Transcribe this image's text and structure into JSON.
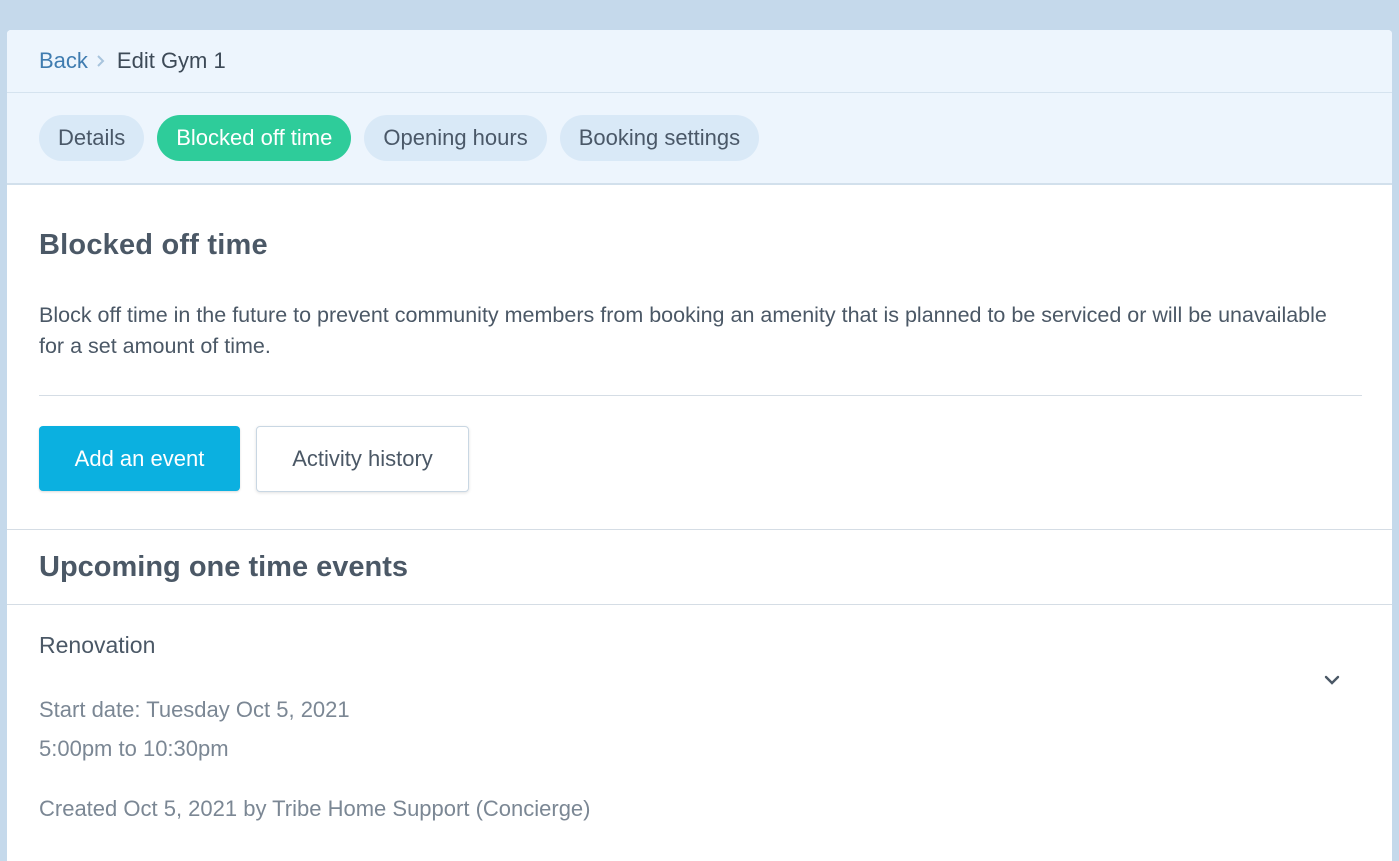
{
  "breadcrumb": {
    "back_label": "Back",
    "current": "Edit Gym 1"
  },
  "tabs": [
    {
      "label": "Details",
      "active": false
    },
    {
      "label": "Blocked off time",
      "active": true
    },
    {
      "label": "Opening hours",
      "active": false
    },
    {
      "label": "Booking settings",
      "active": false
    }
  ],
  "section": {
    "title": "Blocked off time",
    "description": "Block off time in the future to prevent community members from booking an amenity that is planned to be serviced or will be unavailable for a set amount of time.",
    "add_button": "Add an event",
    "history_button": "Activity history"
  },
  "events": {
    "title": "Upcoming one time events",
    "items": [
      {
        "name": "Renovation",
        "start": "Start date: Tuesday Oct 5, 2021",
        "time": "5:00pm to 10:30pm",
        "created": "Created Oct 5, 2021 by Tribe Home Support (Concierge)"
      }
    ]
  },
  "colors": {
    "accent_green": "#2ecc9a",
    "primary_blue": "#0bb0e0",
    "link_blue": "#3f7cb0"
  },
  "icons": {
    "breadcrumb_separator": "chevron-right-icon",
    "event_toggle": "chevron-down-icon"
  }
}
